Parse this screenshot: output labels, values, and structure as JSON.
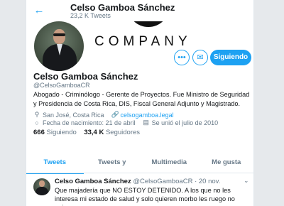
{
  "header": {
    "back_icon": "arrow-left-icon",
    "name": "Celso Gamboa Sánchez",
    "tweet_count": "23,2 K Tweets"
  },
  "banner": {
    "text": "COMPANY"
  },
  "actions": {
    "more_label": "•••",
    "message_icon": "envelope-icon",
    "follow_label": "Siguiendo"
  },
  "profile": {
    "name": "Celso Gamboa Sánchez",
    "handle": "@CelsoGamboaCR",
    "bio": "Abogado - Criminólogo - Gerente de Proyectos. Fue Ministro de Seguridad y Presidencia de Costa Rica, DIS, Fiscal General Adjunto y Magistrado.",
    "location": "San José, Costa Rica",
    "website": "celsogamboa.legal",
    "birthday": "Fecha de nacimiento: 21 de abril",
    "joined": "Se unió el julio de 2010",
    "following_count": "666",
    "following_label": "Siguiendo",
    "followers_count": "33,4 K",
    "followers_label": "Seguidores"
  },
  "tabs": [
    {
      "label": "Tweets",
      "active": true
    },
    {
      "label": "Tweets y respuestas",
      "active": false
    },
    {
      "label": "Multimedia",
      "active": false
    },
    {
      "label": "Me gusta",
      "active": false
    }
  ],
  "tweet": {
    "author": "Celso Gamboa Sánchez",
    "handle": "@CelsoGamboaCR",
    "separator": "·",
    "date": "20 nov.",
    "text": "Que majadería que NO ESTOY DETENIDO. A los que no les interesa mi estado de salud y solo quieren morbo les ruego no opinar."
  },
  "colors": {
    "accent": "#1da1f2",
    "muted": "#657786",
    "text": "#14171a"
  }
}
